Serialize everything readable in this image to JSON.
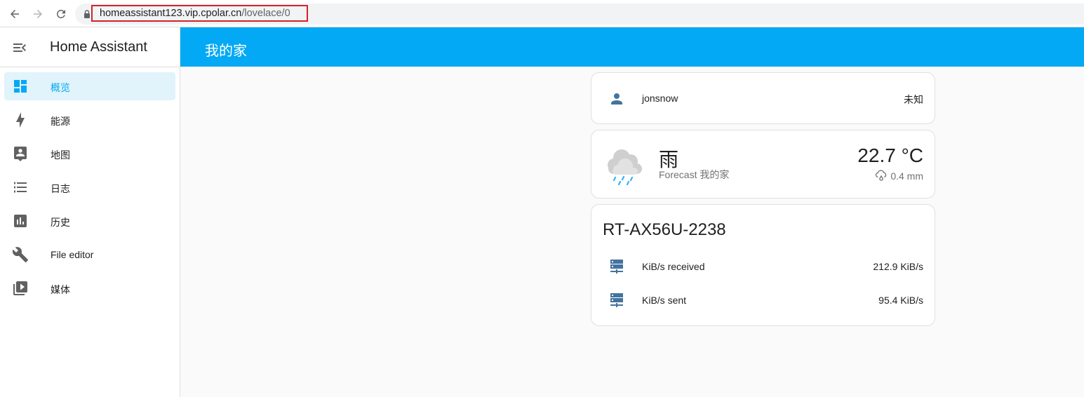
{
  "browser": {
    "url_host": "homeassistant123.vip.cpolar.cn",
    "url_path": "/lovelace/0"
  },
  "sidebar": {
    "title": "Home Assistant",
    "items": [
      {
        "label": "概览",
        "icon": "view-dashboard-icon",
        "active": true
      },
      {
        "label": "能源",
        "icon": "lightning-bolt-icon"
      },
      {
        "label": "地图",
        "icon": "map-account-icon"
      },
      {
        "label": "日志",
        "icon": "format-list-icon"
      },
      {
        "label": "历史",
        "icon": "chart-box-icon"
      },
      {
        "label": "File editor",
        "icon": "wrench-icon"
      },
      {
        "label": "媒体",
        "icon": "play-box-multiple-icon"
      }
    ]
  },
  "header": {
    "title": "我的家"
  },
  "person_card": {
    "name": "jonsnow",
    "state": "未知",
    "icon": "account-icon"
  },
  "weather_card": {
    "condition": "雨",
    "name": "Forecast 我的家",
    "temperature": "22.7 °C",
    "precipitation": "0.4 mm",
    "icon": "rainy-weather-icon"
  },
  "router_card": {
    "title": "RT-AX56U-2238",
    "rows": [
      {
        "name": "KiB/s received",
        "value": "212.9 KiB/s",
        "icon": "server-network-icon"
      },
      {
        "name": "KiB/s sent",
        "value": "95.4 KiB/s",
        "icon": "server-network-icon"
      }
    ]
  },
  "colors": {
    "accent": "#03a9f4",
    "icon": "#44739e",
    "active_bg": "#e1f3fb",
    "highlight_box": "#d3222a"
  }
}
